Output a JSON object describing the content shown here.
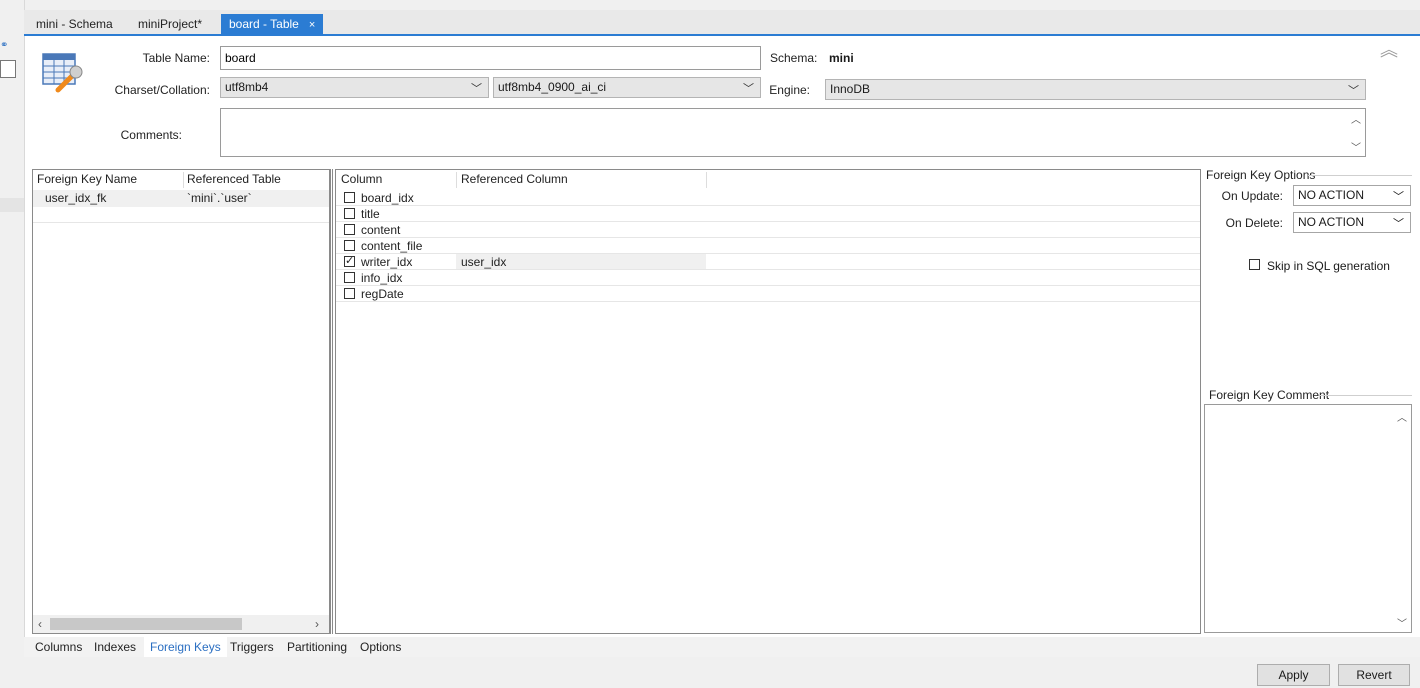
{
  "tabs": [
    {
      "label": "mini - Schema"
    },
    {
      "label": "miniProject*"
    },
    {
      "label": "board - Table",
      "close": "×"
    }
  ],
  "form": {
    "table_name_label": "Table Name:",
    "table_name_value": "board",
    "schema_label": "Schema:",
    "schema_value": "mini",
    "charset_label": "Charset/Collation:",
    "charset_value": "utf8mb4",
    "collation_value": "utf8mb4_0900_ai_ci",
    "engine_label": "Engine:",
    "engine_value": "InnoDB",
    "comments_label": "Comments:"
  },
  "fk_list": {
    "headers": [
      "Foreign Key Name",
      "Referenced Table"
    ],
    "rows": [
      {
        "name": "user_idx_fk",
        "table": "`mini`.`user`"
      }
    ]
  },
  "fk_columns": {
    "headers": [
      "Column",
      "Referenced Column"
    ],
    "rows": [
      {
        "column": "board_idx",
        "checked": false,
        "ref": ""
      },
      {
        "column": "title",
        "checked": false,
        "ref": ""
      },
      {
        "column": "content",
        "checked": false,
        "ref": ""
      },
      {
        "column": "content_file",
        "checked": false,
        "ref": ""
      },
      {
        "column": "writer_idx",
        "checked": true,
        "ref": "user_idx"
      },
      {
        "column": "info_idx",
        "checked": false,
        "ref": ""
      },
      {
        "column": "regDate",
        "checked": false,
        "ref": ""
      }
    ]
  },
  "fk_options": {
    "title": "Foreign Key Options",
    "on_update_label": "On Update:",
    "on_update_value": "NO ACTION",
    "on_delete_label": "On Delete:",
    "on_delete_value": "NO ACTION",
    "skip_label": "Skip in SQL generation",
    "comment_title": "Foreign Key Comment"
  },
  "bottom_tabs": [
    "Columns",
    "Indexes",
    "Foreign Keys",
    "Triggers",
    "Partitioning",
    "Options"
  ],
  "buttons": {
    "apply": "Apply",
    "revert": "Revert"
  },
  "colors": {
    "accent": "#2b7cd3"
  }
}
